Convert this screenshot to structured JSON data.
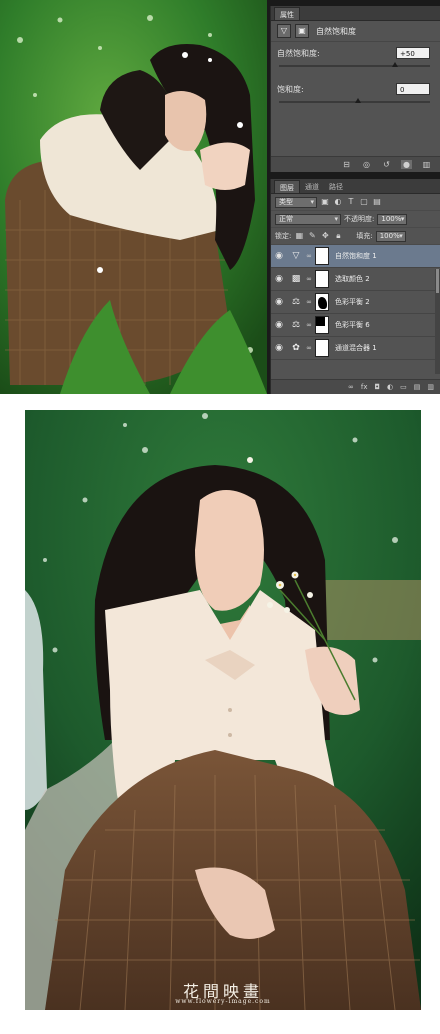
{
  "properties_panel": {
    "tab": "属性",
    "title": "自然饱和度",
    "vibrance_label": "自然饱和度:",
    "vibrance_value": "+50",
    "saturation_label": "饱和度:",
    "saturation_value": "0"
  },
  "layers_panel": {
    "tabs": [
      "图层",
      "通道",
      "路径"
    ],
    "filter_kind": "类型",
    "blend_mode": "正常",
    "opacity_label": "不透明度:",
    "opacity_value": "100%",
    "lock_label": "锁定:",
    "fill_label": "填充:",
    "fill_value": "100%",
    "layers": [
      {
        "name": "自然饱和度 1",
        "icon": "vibrance-triangle-icon",
        "selected": true
      },
      {
        "name": "选取颜色 2",
        "icon": "selective-color-icon",
        "selected": false
      },
      {
        "name": "色彩平衡 2",
        "icon": "balance-scale-icon",
        "selected": false
      },
      {
        "name": "色彩平衡 6",
        "icon": "balance-scale-icon",
        "selected": false
      },
      {
        "name": "通道混合器 1",
        "icon": "channel-mixer-icon",
        "selected": false
      }
    ]
  },
  "watermark": {
    "title": "花間映畫",
    "url": "www.flowery-image.com"
  },
  "colors": {
    "panel_bg": "#535353",
    "selected_layer": "#6b7a8e",
    "foliage": "#2f7a34",
    "skirt": "#6b4a32",
    "blouse": "#f2e6d8"
  }
}
